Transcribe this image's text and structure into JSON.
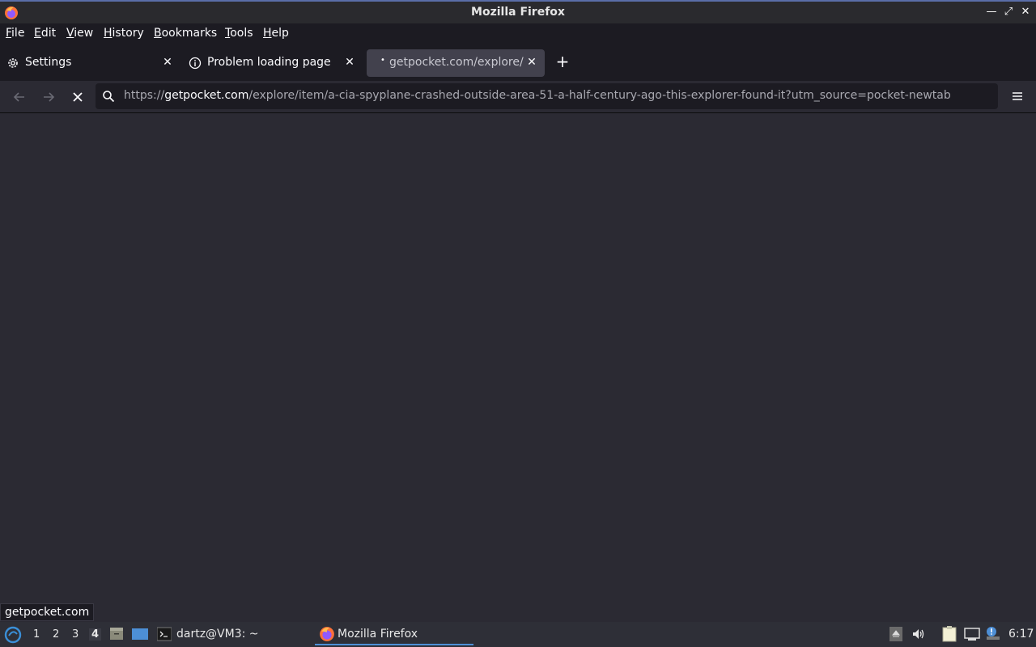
{
  "window": {
    "title": "Mozilla Firefox"
  },
  "menubar": {
    "items": [
      {
        "label": "File",
        "mnemonic": "F",
        "rest": "ile"
      },
      {
        "label": "Edit",
        "mnemonic": "E",
        "rest": "dit"
      },
      {
        "label": "View",
        "mnemonic": "V",
        "rest": "iew"
      },
      {
        "label": "History",
        "mnemonic": "H",
        "rest": "istory"
      },
      {
        "label": "Bookmarks",
        "mnemonic": "B",
        "rest": "ookmarks"
      },
      {
        "label": "Tools",
        "mnemonic": "T",
        "rest": "ools"
      },
      {
        "label": "Help",
        "mnemonic": "H",
        "rest": "elp"
      }
    ]
  },
  "tabs": [
    {
      "label": "Settings",
      "icon": "gear-icon",
      "active": false
    },
    {
      "label": "Problem loading page",
      "icon": "info-icon",
      "active": false
    },
    {
      "label": "getpocket.com/explore/it",
      "icon": "loading-dot",
      "active": true
    }
  ],
  "navbar": {
    "url_prefix": "https://",
    "url_host": "getpocket.com",
    "url_path": "/explore/item/a-cia-spyplane-crashed-outside-area-51-a-half-century-ago-this-explorer-found-it?utm_source=pocket-newtab",
    "loading": true
  },
  "status": {
    "tooltip": "getpocket.com"
  },
  "taskbar": {
    "workspaces": [
      "1",
      "2",
      "3",
      "4"
    ],
    "current_workspace": "4",
    "terminal_label": "dartz@VM3: ~",
    "firefox_label": "Mozilla Firefox",
    "clock": "6:17"
  },
  "colors": {
    "accent": "#4d8fd6",
    "background": "#2b2a33",
    "toolbar": "#1c1b22"
  }
}
